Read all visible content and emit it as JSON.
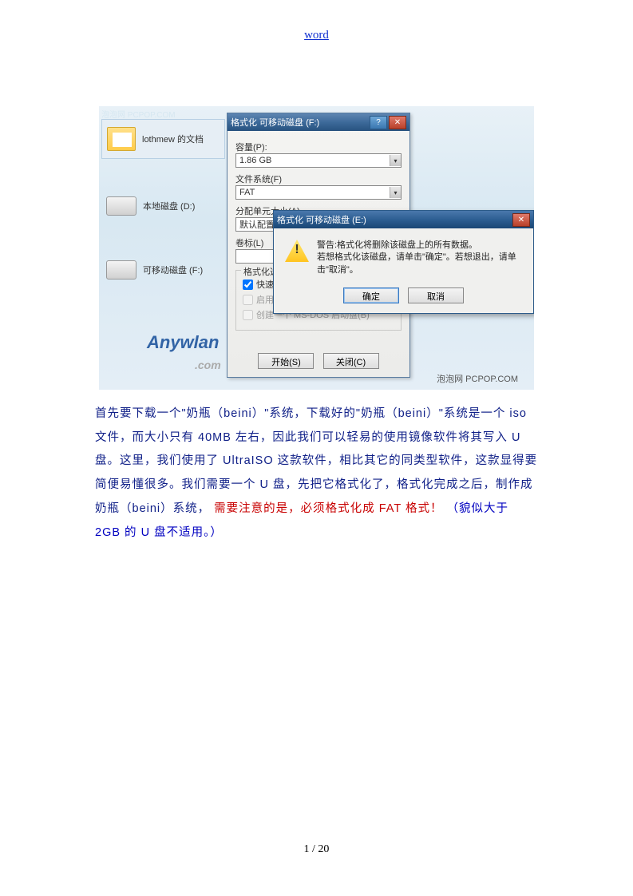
{
  "page_link": "word",
  "sidebar": {
    "docs_label": "lothmew 的文档",
    "local_disk": "本地磁盘 (D:)",
    "removable_disk": "可移动磁盘 (F:)"
  },
  "format_dialog": {
    "title": "格式化 可移动磁盘 (F:)",
    "capacity_label": "容量(P):",
    "capacity_value": "1.86 GB",
    "fs_label": "文件系统(F)",
    "fs_value": "FAT",
    "alloc_label": "分配单元大小(A)",
    "alloc_value": "默认配置大小",
    "volume_label": "卷标(L)",
    "options_group": "格式化选项",
    "opt_quick": "快速格式化",
    "opt_enable": "启用",
    "opt_create": "创建一个 MS-DOS 启动盘(B)",
    "btn_start": "开始(S)",
    "btn_close": "关闭(C)"
  },
  "warn_dialog": {
    "title": "格式化 可移动磁盘 (E:)",
    "line1": "警告:格式化将删除该磁盘上的所有数据。",
    "line2": "若想格式化该磁盘，请单击\"确定\"。若想退出，请单击\"取消\"。",
    "btn_ok": "确定",
    "btn_cancel": "取消"
  },
  "watermark": {
    "top": "泡泡网 PCPOP.COM",
    "logo_main": "Anywlan",
    "logo_sub": ".com",
    "bottom": "泡泡网  PCPOP.COM"
  },
  "body": {
    "p1a": "首先要下载一个\"奶瓶（beini）\"系统，下载好的\"奶瓶（beini）\"系统是一个 iso 文件，而大小只有 40MB 左右，因此我们可以轻易的使用镜像软件将其写入 U 盘。这里，我们使用了 UltraISO 这款软件，相比其它的同类型软件，这款显得要简便易懂很多。我们需要一个 U 盘，先把它格式化了，格式化完成之后，制作成奶瓶（beini）系统，",
    "p1b": " 需要注意的是，必须格式化成 FAT 格式！",
    "p1c": "（貌似大于 2GB 的 U 盘不适用。）"
  },
  "footer": "1 / 20"
}
